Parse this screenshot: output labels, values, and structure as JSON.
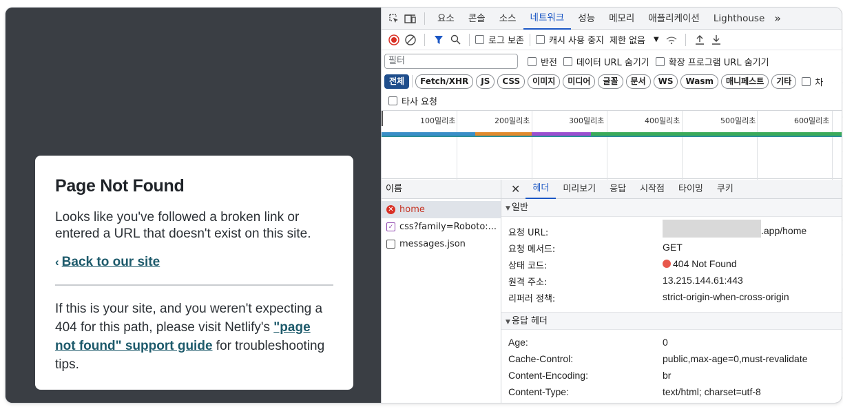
{
  "page": {
    "title": "Page Not Found",
    "intro": "Looks like you've followed a broken link or entered a URL that doesn't exist on this site.",
    "back_link": "Back to our site",
    "para_start": "If this is your site, and you weren't expecting a 404 for this path, please visit Netlify's ",
    "para_link": "\"page not found\" support guide",
    "para_end": " for troubleshooting tips."
  },
  "devtools": {
    "tabs": [
      "요소",
      "콘솔",
      "소스",
      "네트워크",
      "성능",
      "메모리",
      "애플리케이션",
      "Lighthouse"
    ],
    "active_tab": "네트워크",
    "more_tabs_glyph": "»",
    "toolbar": {
      "preserve_log": "로그 보존",
      "disable_cache": "캐시 사용 중지",
      "throttling": "제한 없음"
    },
    "filter": {
      "placeholder": "필터",
      "invert": "반전",
      "hide_data_urls": "데이터 URL 숨기기",
      "hide_extension_urls": "확장 프로그램 URL 숨기기"
    },
    "type_chips": [
      "전체",
      "Fetch/XHR",
      "JS",
      "CSS",
      "이미지",
      "미디어",
      "글꼴",
      "문서",
      "WS",
      "Wasm",
      "매니페스트",
      "기타"
    ],
    "blocked_label": "차",
    "third_party": "타사 요청",
    "timeline_ticks": [
      "100밀리초",
      "200밀리초",
      "300밀리초",
      "400밀리초",
      "500밀리초",
      "600밀리초"
    ],
    "name_header": "이름",
    "requests": [
      {
        "name": "home",
        "status": "error"
      },
      {
        "name": "css?family=Roboto:...",
        "status": "stylesheet"
      },
      {
        "name": "messages.json",
        "status": "document"
      }
    ],
    "detail_tabs": [
      "헤더",
      "미리보기",
      "응답",
      "시작점",
      "타이밍",
      "쿠키"
    ],
    "general": {
      "title": "일반",
      "rows": [
        {
          "key": "요청 URL:",
          "value": ".app/home"
        },
        {
          "key": "요청 메서드:",
          "value": "GET"
        },
        {
          "key": "상태 코드:",
          "value": "404 Not Found"
        },
        {
          "key": "원격 주소:",
          "value": "13.215.144.61:443"
        },
        {
          "key": "리퍼러 정책:",
          "value": "strict-origin-when-cross-origin"
        }
      ]
    },
    "response_headers": {
      "title": "응답 헤더",
      "rows": [
        {
          "key": "Age:",
          "value": "0"
        },
        {
          "key": "Cache-Control:",
          "value": "public,max-age=0,must-revalidate"
        },
        {
          "key": "Content-Encoding:",
          "value": "br"
        },
        {
          "key": "Content-Type:",
          "value": "text/html; charset=utf-8"
        }
      ]
    }
  },
  "colors": {
    "accent": "#1a56c4",
    "error": "#d93025",
    "link": "#1d5a6b",
    "viewport_bg": "#3a3e44"
  }
}
